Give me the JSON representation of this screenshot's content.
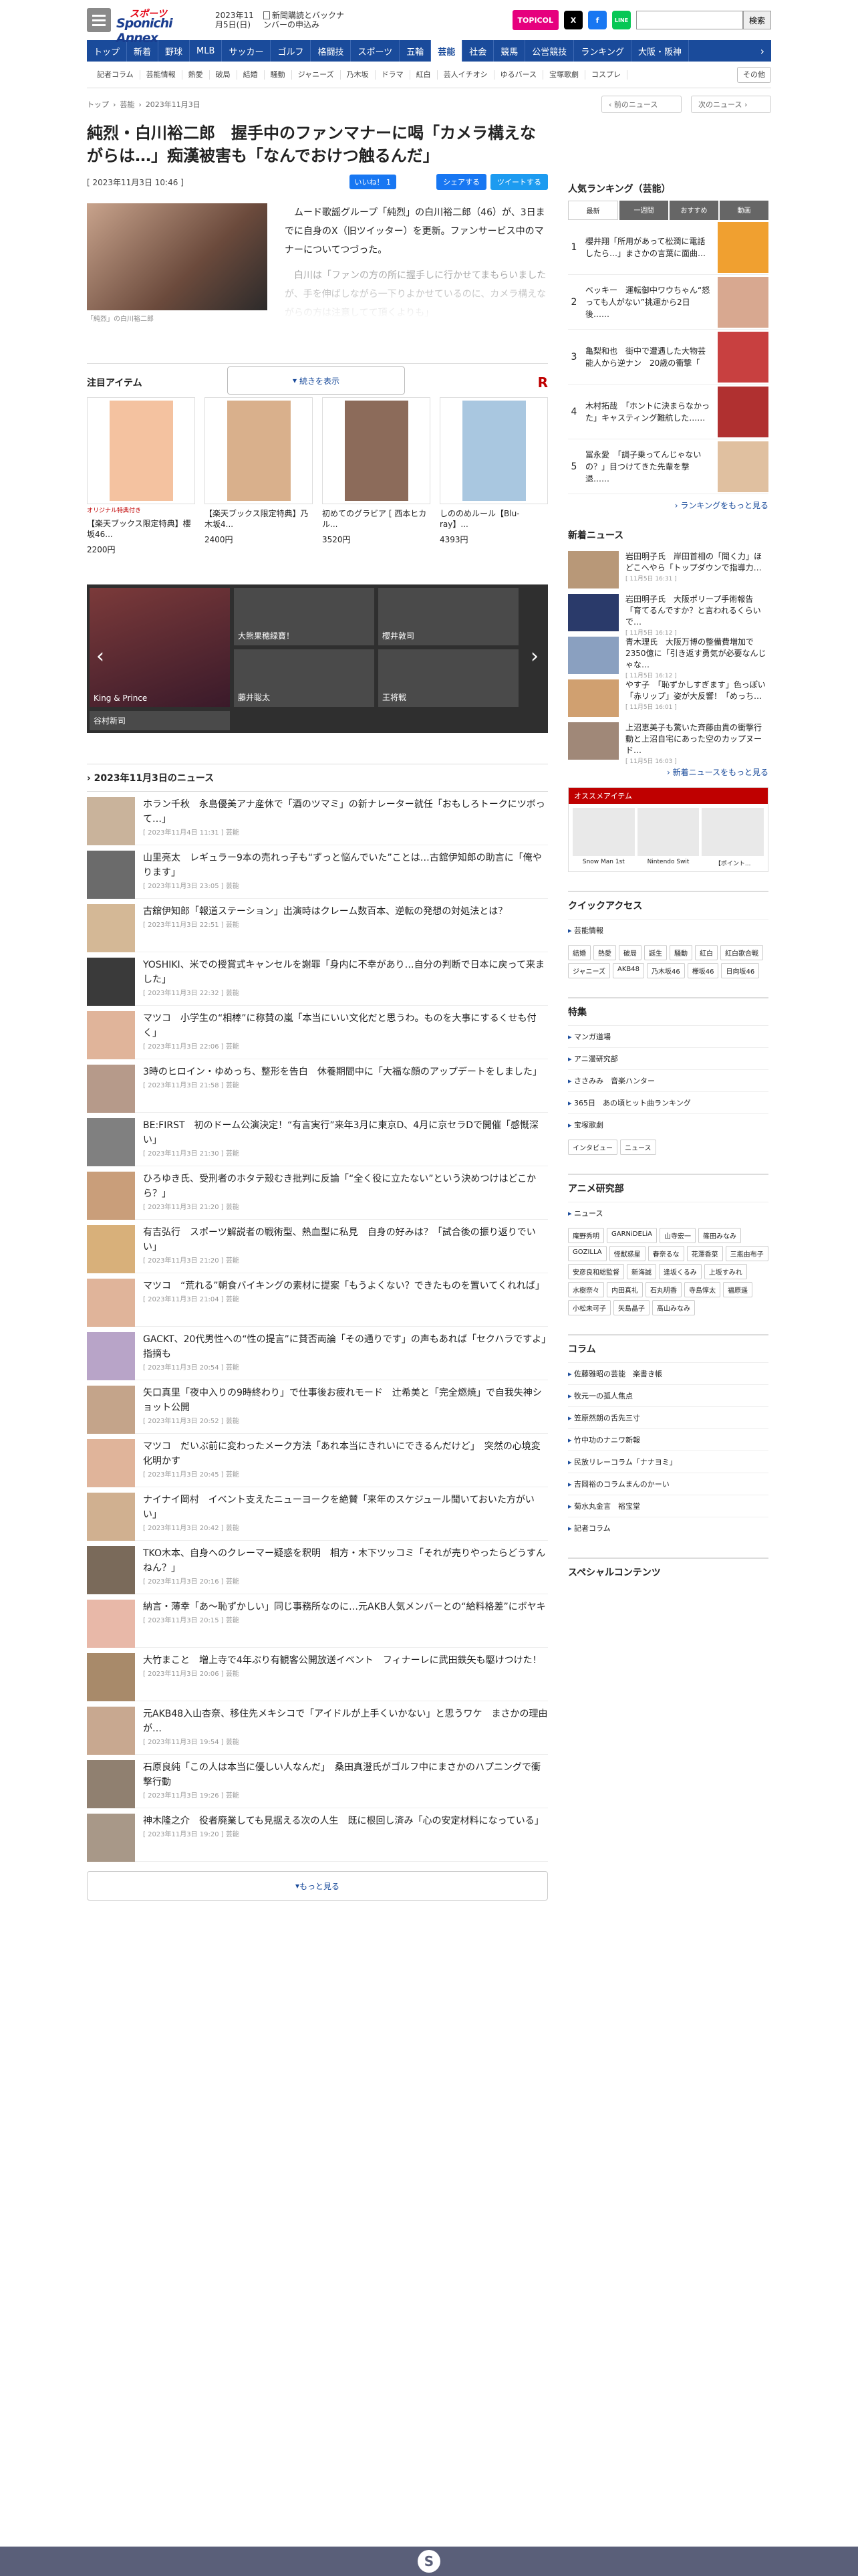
{
  "header": {
    "logo_top": "スポーツ",
    "logo_main": "Sponichi Annex",
    "date": "2023年11月5日(日)",
    "news_link": "新聞購読とバックナンバーの申込み",
    "topicol": "TOPICOL",
    "sns": [
      "X",
      "f",
      "LINE"
    ],
    "search_button": "検索"
  },
  "gnav": [
    "トップ",
    "新着",
    "野球",
    "MLB",
    "サッカー",
    "ゴルフ",
    "格闘技",
    "スポーツ",
    "五輪",
    "芸能",
    "社会",
    "競馬",
    "公営競技",
    "ランキング",
    "大阪・阪神"
  ],
  "gnav_active": "芸能",
  "snav": [
    "記者コラム",
    "芸能情報",
    "熱愛",
    "破局",
    "結婚",
    "騒動",
    "ジャニーズ",
    "乃木坂",
    "ドラマ",
    "紅白",
    "芸人イチオシ",
    "ゆるバース",
    "宝塚歌劇",
    "コスプレ"
  ],
  "snav_more": "その他",
  "breadcrumb": [
    "トップ",
    "芸能",
    "2023年11月3日"
  ],
  "pager": {
    "prev": "前のニュース",
    "next": "次のニュース"
  },
  "article": {
    "title": "純烈・白川裕二郎　握手中のファンマナーに喝「カメラ構えながらは…」痴漢被害も「なんでおけつ触るんだ」",
    "date": "[ 2023年11月3日 10:46 ]",
    "like": "いいね！ 1",
    "share": "シェアする",
    "tweet": "ツイートする",
    "caption": "「純烈」の白川裕二郎",
    "lead": "　ムード歌謡グループ「純烈」の白川裕二郎（46）が、3日までに自身のX（旧ツイッター）を更新。ファンサービス中のマナーについてつづった。",
    "faded": "　白川は「ファンの方の所に握手しに行かせてまもらいましたが、手を伸ばしながら一下りよかせているのに、カメラ構えながらの方は注意してて頂くよりも」",
    "continue": "続きを表示"
  },
  "goods": {
    "heading": "注目アイテム",
    "brand": "R",
    "items": [
      {
        "name": "【楽天ブックス限定特典】櫻坂46...",
        "price": "2200円",
        "badge": "オリジナル特典付き"
      },
      {
        "name": "【楽天ブックス限定特典】乃木坂4...",
        "price": "2400円",
        "badge": ""
      },
      {
        "name": "初めてのグラビア [ 西本ヒカル...",
        "price": "3520円",
        "badge": ""
      },
      {
        "name": "しののめルール【Blu-ray】...",
        "price": "4393円",
        "badge": ""
      }
    ]
  },
  "carousel": [
    "大熊果穂緑寶！",
    "櫻井敦司",
    "藤井聡太",
    "King & Prince",
    "王将戦",
    "谷村新司"
  ],
  "news_heading": "2023年11月3日のニュース",
  "news": [
    {
      "title": "ホラン千秋　永島優美アナ産休で「酒のツマミ」の新ナレーター就任「おもしろトークにツボって…」",
      "date": "[ 2023年11月4日 11:31 ] 芸能"
    },
    {
      "title": "山里亮太　レギュラー9本の売れっ子も“ずっと悩んでいた”ことは…古舘伊知郎の助言に「俺やります」",
      "date": "[ 2023年11月3日 23:05 ] 芸能"
    },
    {
      "title": "古舘伊知郎「報道ステーション」出演時はクレーム数百本、逆転の発想の対処法とは？",
      "date": "[ 2023年11月3日 22:51 ] 芸能"
    },
    {
      "title": "YOSHIKI、米での授賞式キャンセルを謝罪「身内に不幸があり…自分の判断で日本に戻って来ました」",
      "date": "[ 2023年11月3日 22:32 ] 芸能"
    },
    {
      "title": "マツコ　小学生の“相棒”に称賛の嵐「本当にいい文化だと思うわ。ものを大事にするくせも付く」",
      "date": "[ 2023年11月3日 22:06 ] 芸能"
    },
    {
      "title": "3時のヒロイン・ゆめっち、整形を告白　休養期間中に「大福な顔のアップデートをしました」",
      "date": "[ 2023年11月3日 21:58 ] 芸能"
    },
    {
      "title": "BE:FIRST　初のドーム公演決定！“有言実行”来年3月に東京D、4月に京セラDで開催「感慨深い」",
      "date": "[ 2023年11月3日 21:30 ] 芸能"
    },
    {
      "title": "ひろゆき氏、受刑者のホタテ殻むき批判に反論「“全く役に立たない”という決めつけはどこから？」",
      "date": "[ 2023年11月3日 21:20 ] 芸能"
    },
    {
      "title": "有吉弘行　スポーツ解説者の戦術型、熱血型に私見　自身の好みは？「試合後の振り返りでいい」",
      "date": "[ 2023年11月3日 21:20 ] 芸能"
    },
    {
      "title": "マツコ　“荒れる”朝食バイキングの素材に提案「もうよくない？できたものを置いてくれれば」",
      "date": "[ 2023年11月3日 21:04 ] 芸能"
    },
    {
      "title": "GACKT、20代男性への“性の提言”に賛否両論「その通りです」の声もあれば「セクハラですよ」指摘も",
      "date": "[ 2023年11月3日 20:54 ] 芸能"
    },
    {
      "title": "矢口真里「夜中入りの9時終わり」で仕事後お疲れモード　辻希美と「完全燃焼」で自我失神ショット公開",
      "date": "[ 2023年11月3日 20:52 ] 芸能"
    },
    {
      "title": "マツコ　だいぶ前に変わったメーク方法「あれ本当にきれいにできるんだけど」　突然の心境変化明かす",
      "date": "[ 2023年11月3日 20:45 ] 芸能"
    },
    {
      "title": "ナイナイ岡村　イベント支えたニューヨークを絶賛「来年のスケジュール聞いておいた方がいい」",
      "date": "[ 2023年11月3日 20:42 ] 芸能"
    },
    {
      "title": "TKO木本、自身へのクレーマー疑惑を釈明　相方・木下ツッコミ「それが売りやったらどうすんねん？」",
      "date": "[ 2023年11月3日 20:16 ] 芸能"
    },
    {
      "title": "納言・薄幸「あ〜恥ずかしい」同じ事務所なのに…元AKB人気メンバーとの“給料格差”にボヤキ",
      "date": "[ 2023年11月3日 20:15 ] 芸能"
    },
    {
      "title": "大竹まこと　増上寺で4年ぶり有観客公開放送イベント　フィナーレに武田鉄矢も駆けつけた！",
      "date": "[ 2023年11月3日 20:06 ] 芸能"
    },
    {
      "title": "元AKB48入山杏奈、移住先メキシコで「アイドルが上手くいかない」と思うワケ　まさかの理由が…",
      "date": "[ 2023年11月3日 19:54 ] 芸能"
    },
    {
      "title": "石原良純「この人は本当に優しい人なんだ」　桑田真澄氏がゴルフ中にまさかのハプニングで衝撃行動",
      "date": "[ 2023年11月3日 19:26 ] 芸能"
    },
    {
      "title": "神木隆之介　役者廃業しても見据える次の人生　既に根回し済み「心の安定材料になっている」",
      "date": "[ 2023年11月3日 19:20 ] 芸能"
    }
  ],
  "news_more": "もっと見る",
  "ranking": {
    "heading": "人気ランキング（芸能）",
    "tabs": [
      "最新",
      "一週間",
      "おすすめ",
      "動画"
    ],
    "items": [
      {
        "n": "1",
        "t": "櫻井翔「所用があって松潤に電話したら…」まさかの言葉に面曲…"
      },
      {
        "n": "2",
        "t": "ベッキー　運転御中ワウちゃん“怒っても人がない”挑運から2日後……"
      },
      {
        "n": "3",
        "t": "亀梨和也　街中で遭遇した大物芸能人から逆ナン　20歳の衝撃「"
      },
      {
        "n": "4",
        "t": "木村拓哉　「ホントに決まらなかった」キャスティング難航した……"
      },
      {
        "n": "5",
        "t": "冨永愛　「調子乗ってんじゃないの？」目つけてきた先輩を撃退……"
      }
    ],
    "more": "ランキングをもっと見る"
  },
  "latest": {
    "heading": "新着ニュース",
    "items": [
      {
        "t": "岩田明子氏　岸田首相の「聞く力」ほどこへやら「トップダウンで指導力…",
        "d": "[ 11月5日 16:31 ]"
      },
      {
        "t": "岩田明子氏　大阪ポリープ手術報告「育てるんですか？と言われるくらいで…",
        "d": "[ 11月5日 16:12 ]"
      },
      {
        "t": "青木理氏　大阪万博の整備費増加で2350億に「引き返す勇気が必要なんじゃな…",
        "d": "[ 11月5日 16:12 ]"
      },
      {
        "t": "やす子　「恥ずかしすぎます」色っぽい「赤リップ」姿が大反響！「めっち…",
        "d": "[ 11月5日 16:01 ]"
      },
      {
        "t": "上沼恵美子も驚いた斉藤由貴の衝撃行動と上沼自宅にあった空のカップヌード…",
        "d": "[ 11月5日 16:03 ]"
      }
    ],
    "more": "新着ニュースをもっと見る"
  },
  "osusume": {
    "heading": "オススメアイテム",
    "items": [
      "Snow Man 1st",
      "Nintendo Swit",
      "【ポイント..."
    ]
  },
  "quick": {
    "heading": "クイックアクセス",
    "sub": "芸能情報",
    "tags": [
      "結婚",
      "熱愛",
      "破局",
      "誕生",
      "騒動",
      "紅白",
      "紅白歌合戦",
      "ジャニーズ",
      "AKB48",
      "乃木坂46",
      "欅坂46",
      "日向坂46"
    ]
  },
  "feature": {
    "heading": "特集",
    "items": [
      "マンガ道場",
      "アニ漫研究部",
      "ささみみ　音楽ハンター",
      "365日　あの頃ヒット曲ランキング",
      "宝塚歌劇"
    ],
    "tags": [
      "インタビュー",
      "ニュース"
    ]
  },
  "anime": {
    "heading": "アニメ研究部",
    "sub": "ニュース",
    "tags": [
      "庵野秀明",
      "GARNiDELiA",
      "山寺宏一",
      "篠田みなみ",
      "GOZILLA",
      "怪獣惑星",
      "春奈るな",
      "花澤香菜",
      "三瓶由布子",
      "安彦良和総監督",
      "新海誠",
      "逢坂くるみ",
      "上坂すみれ",
      "水樹奈々",
      "内田真礼",
      "石丸明香",
      "寺島惇太",
      "福原遥",
      "小松未可子",
      "矢島晶子",
      "高山みなみ"
    ]
  },
  "column": {
    "heading": "コラム",
    "items": [
      "佐藤雅昭の芸能　楽書き帳",
      "牧元一の孤人焦点",
      "笠原然朗の舌先三寸",
      "竹中功のナニワ新報",
      "民放リレーコラム「ナナヨミ」",
      "吉岡裕のコラムまんのかーい",
      "菊水丸金言　裕宝堂",
      "記者コラム"
    ]
  },
  "special": {
    "heading": "スペシャルコンテンツ"
  },
  "colors": {
    "brand_blue": "#1a4b9b",
    "rakuten_red": "#bf0000",
    "footer": "#5a5f79"
  }
}
